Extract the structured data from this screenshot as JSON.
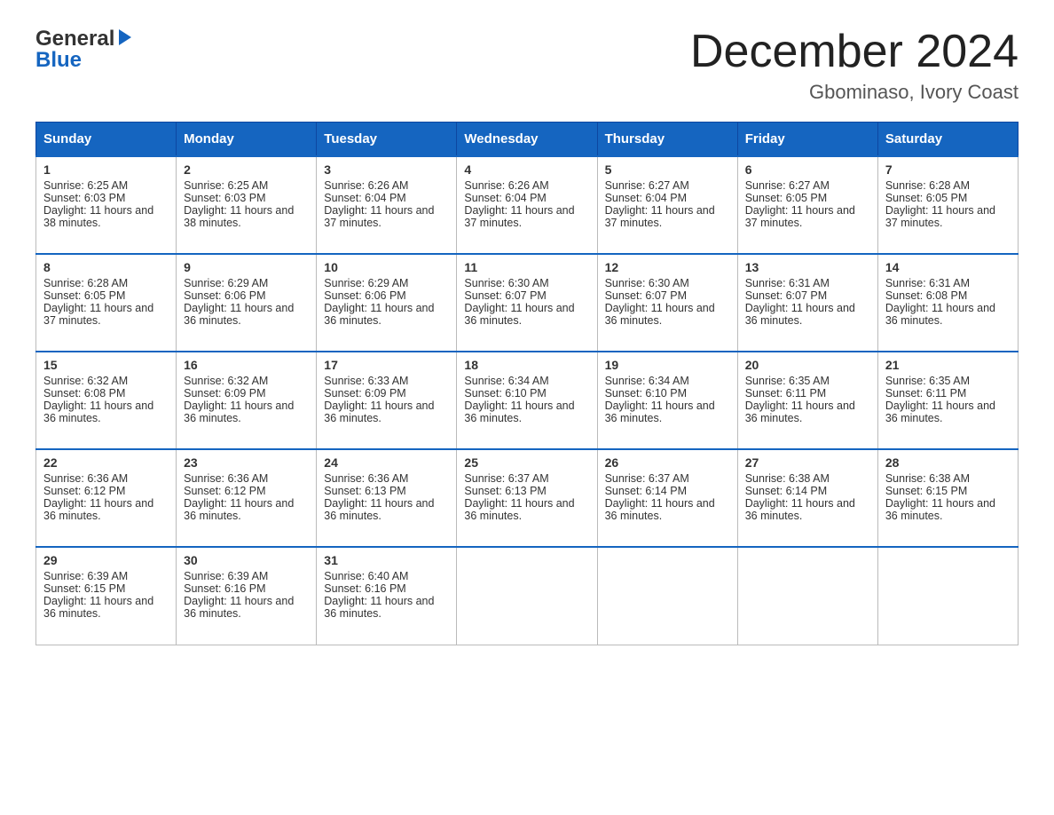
{
  "header": {
    "logo_general": "General",
    "logo_blue": "Blue",
    "month_title": "December 2024",
    "location": "Gbominaso, Ivory Coast"
  },
  "days_of_week": [
    "Sunday",
    "Monday",
    "Tuesday",
    "Wednesday",
    "Thursday",
    "Friday",
    "Saturday"
  ],
  "weeks": [
    [
      {
        "day": "1",
        "sunrise": "6:25 AM",
        "sunset": "6:03 PM",
        "daylight": "11 hours and 38 minutes."
      },
      {
        "day": "2",
        "sunrise": "6:25 AM",
        "sunset": "6:03 PM",
        "daylight": "11 hours and 38 minutes."
      },
      {
        "day": "3",
        "sunrise": "6:26 AM",
        "sunset": "6:04 PM",
        "daylight": "11 hours and 37 minutes."
      },
      {
        "day": "4",
        "sunrise": "6:26 AM",
        "sunset": "6:04 PM",
        "daylight": "11 hours and 37 minutes."
      },
      {
        "day": "5",
        "sunrise": "6:27 AM",
        "sunset": "6:04 PM",
        "daylight": "11 hours and 37 minutes."
      },
      {
        "day": "6",
        "sunrise": "6:27 AM",
        "sunset": "6:05 PM",
        "daylight": "11 hours and 37 minutes."
      },
      {
        "day": "7",
        "sunrise": "6:28 AM",
        "sunset": "6:05 PM",
        "daylight": "11 hours and 37 minutes."
      }
    ],
    [
      {
        "day": "8",
        "sunrise": "6:28 AM",
        "sunset": "6:05 PM",
        "daylight": "11 hours and 37 minutes."
      },
      {
        "day": "9",
        "sunrise": "6:29 AM",
        "sunset": "6:06 PM",
        "daylight": "11 hours and 36 minutes."
      },
      {
        "day": "10",
        "sunrise": "6:29 AM",
        "sunset": "6:06 PM",
        "daylight": "11 hours and 36 minutes."
      },
      {
        "day": "11",
        "sunrise": "6:30 AM",
        "sunset": "6:07 PM",
        "daylight": "11 hours and 36 minutes."
      },
      {
        "day": "12",
        "sunrise": "6:30 AM",
        "sunset": "6:07 PM",
        "daylight": "11 hours and 36 minutes."
      },
      {
        "day": "13",
        "sunrise": "6:31 AM",
        "sunset": "6:07 PM",
        "daylight": "11 hours and 36 minutes."
      },
      {
        "day": "14",
        "sunrise": "6:31 AM",
        "sunset": "6:08 PM",
        "daylight": "11 hours and 36 minutes."
      }
    ],
    [
      {
        "day": "15",
        "sunrise": "6:32 AM",
        "sunset": "6:08 PM",
        "daylight": "11 hours and 36 minutes."
      },
      {
        "day": "16",
        "sunrise": "6:32 AM",
        "sunset": "6:09 PM",
        "daylight": "11 hours and 36 minutes."
      },
      {
        "day": "17",
        "sunrise": "6:33 AM",
        "sunset": "6:09 PM",
        "daylight": "11 hours and 36 minutes."
      },
      {
        "day": "18",
        "sunrise": "6:34 AM",
        "sunset": "6:10 PM",
        "daylight": "11 hours and 36 minutes."
      },
      {
        "day": "19",
        "sunrise": "6:34 AM",
        "sunset": "6:10 PM",
        "daylight": "11 hours and 36 minutes."
      },
      {
        "day": "20",
        "sunrise": "6:35 AM",
        "sunset": "6:11 PM",
        "daylight": "11 hours and 36 minutes."
      },
      {
        "day": "21",
        "sunrise": "6:35 AM",
        "sunset": "6:11 PM",
        "daylight": "11 hours and 36 minutes."
      }
    ],
    [
      {
        "day": "22",
        "sunrise": "6:36 AM",
        "sunset": "6:12 PM",
        "daylight": "11 hours and 36 minutes."
      },
      {
        "day": "23",
        "sunrise": "6:36 AM",
        "sunset": "6:12 PM",
        "daylight": "11 hours and 36 minutes."
      },
      {
        "day": "24",
        "sunrise": "6:36 AM",
        "sunset": "6:13 PM",
        "daylight": "11 hours and 36 minutes."
      },
      {
        "day": "25",
        "sunrise": "6:37 AM",
        "sunset": "6:13 PM",
        "daylight": "11 hours and 36 minutes."
      },
      {
        "day": "26",
        "sunrise": "6:37 AM",
        "sunset": "6:14 PM",
        "daylight": "11 hours and 36 minutes."
      },
      {
        "day": "27",
        "sunrise": "6:38 AM",
        "sunset": "6:14 PM",
        "daylight": "11 hours and 36 minutes."
      },
      {
        "day": "28",
        "sunrise": "6:38 AM",
        "sunset": "6:15 PM",
        "daylight": "11 hours and 36 minutes."
      }
    ],
    [
      {
        "day": "29",
        "sunrise": "6:39 AM",
        "sunset": "6:15 PM",
        "daylight": "11 hours and 36 minutes."
      },
      {
        "day": "30",
        "sunrise": "6:39 AM",
        "sunset": "6:16 PM",
        "daylight": "11 hours and 36 minutes."
      },
      {
        "day": "31",
        "sunrise": "6:40 AM",
        "sunset": "6:16 PM",
        "daylight": "11 hours and 36 minutes."
      },
      null,
      null,
      null,
      null
    ]
  ],
  "labels": {
    "sunrise": "Sunrise:",
    "sunset": "Sunset:",
    "daylight": "Daylight:"
  }
}
